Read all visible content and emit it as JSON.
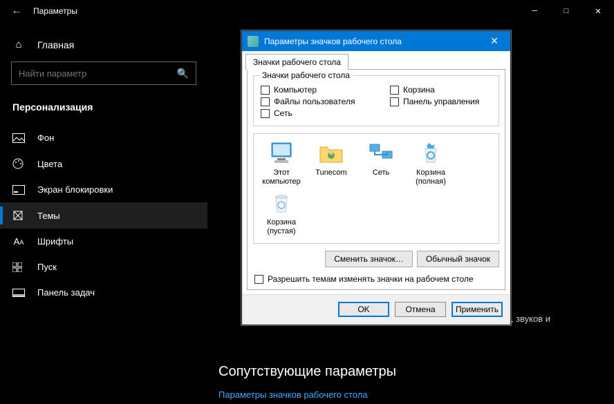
{
  "titlebar": {
    "title": "Параметры"
  },
  "sidebar": {
    "home": "Главная",
    "search_placeholder": "Найти параметр",
    "section": "Персонализация",
    "items": [
      {
        "label": "Фон"
      },
      {
        "label": "Цвета"
      },
      {
        "label": "Экран блокировки"
      },
      {
        "label": "Темы"
      },
      {
        "label": "Шрифты"
      },
      {
        "label": "Пуск"
      },
      {
        "label": "Панель задач"
      }
    ]
  },
  "main": {
    "bg_fragment": "боев, звуков и",
    "related_title": "Сопутствующие параметры",
    "related_link": "Параметры значков рабочего стола"
  },
  "dialog": {
    "title": "Параметры значков рабочего стола",
    "tab": "Значки рабочего стола",
    "group_legend": "Значки рабочего стола",
    "checkboxes": {
      "computer": "Компьютер",
      "recycle": "Корзина",
      "userfiles": "Файлы пользователя",
      "controlpanel": "Панель управления",
      "network": "Сеть"
    },
    "icons": {
      "this_pc_1": "Этот",
      "this_pc_2": "компьютер",
      "tunecom": "Tunecom",
      "network": "Сеть",
      "recycle_full_1": "Корзина",
      "recycle_full_2": "(полная)",
      "recycle_empty_1": "Корзина",
      "recycle_empty_2": "(пустая)"
    },
    "change_icon": "Сменить значок…",
    "default_icon": "Обычный значок",
    "allow_themes": "Разрешить темам изменять значки на рабочем столе",
    "ok": "OK",
    "cancel": "Отмена",
    "apply": "Применить"
  }
}
